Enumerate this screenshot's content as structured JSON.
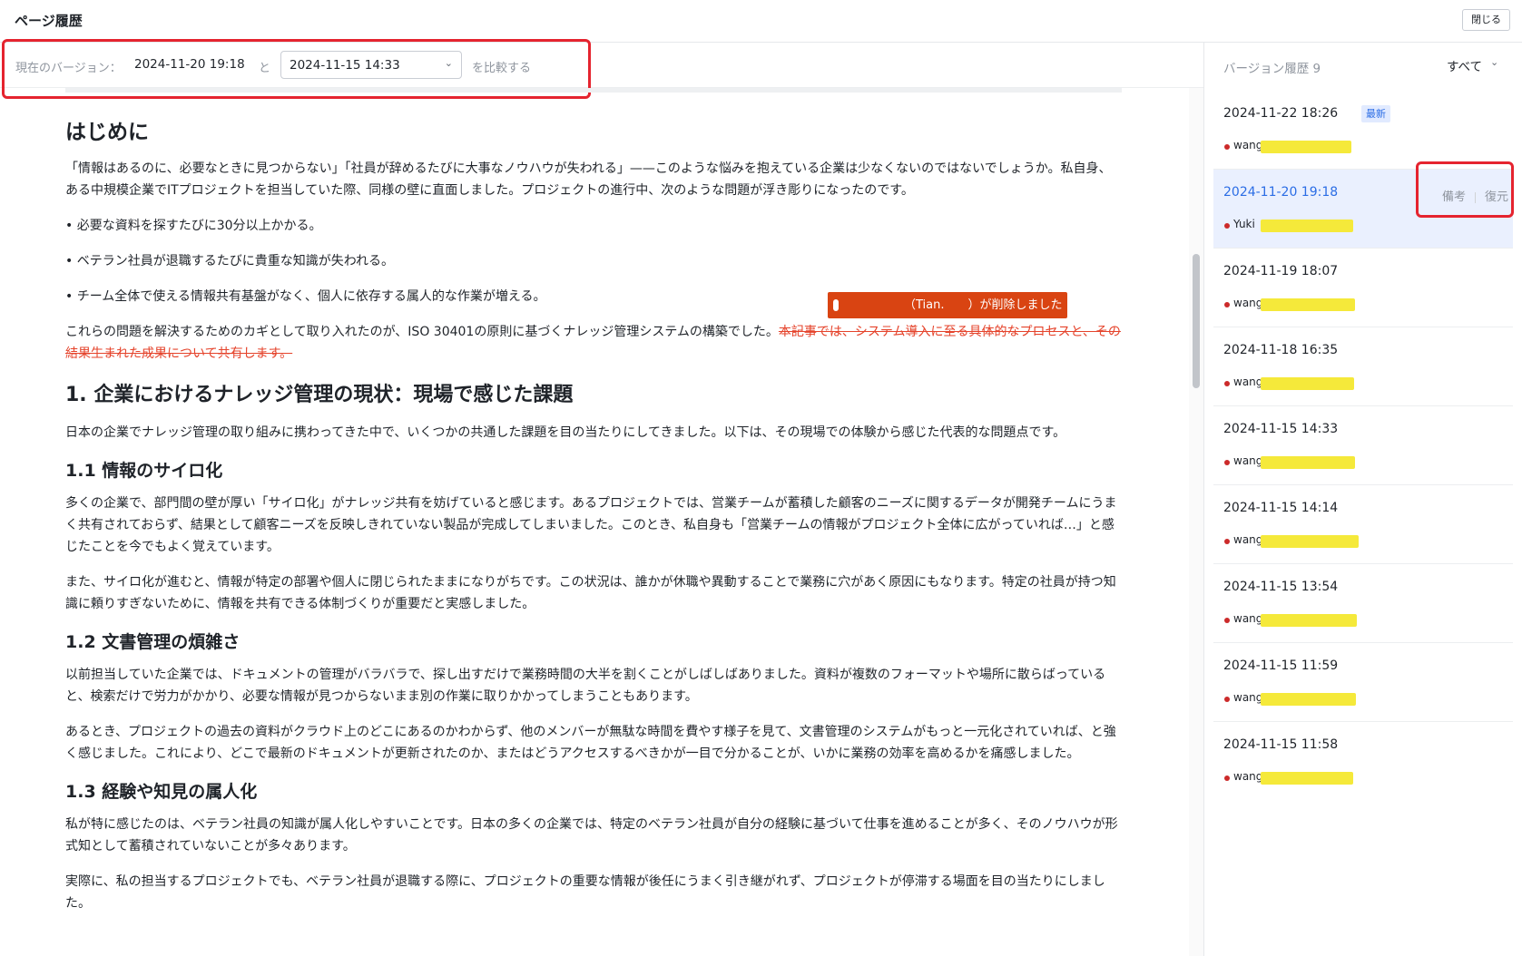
{
  "header": {
    "title": "ページ履歴",
    "close_label": "閉じる"
  },
  "compare": {
    "label": "現在のバージョン：",
    "current_version": "2024-11-20 19:18",
    "and": "と",
    "selected_version": "2024-11-15 14:33",
    "suffix": "を比較する"
  },
  "document": {
    "h_intro": "はじめに",
    "p_intro": "「情報はあるのに、必要なときに見つからない」「社員が辞めるたびに大事なノウハウが失われる」——このような悩みを抱えている企業は少なくないのではないでしょうか。私自身、ある中規模企業でITプロジェクトを担当していた際、同様の壁に直面しました。プロジェクトの進行中、次のような問題が浮き彫りになったのです。",
    "bullets": [
      "• 必要な資料を探すたびに30分以上かかる。",
      "• ベテラン社員が退職するたびに貴重な知識が失われる。",
      "• チーム全体で使える情報共有基盤がなく、個人に依存する属人的な作業が増える。"
    ],
    "p_solution": "これらの問題を解決するためのカギとして取り入れたのが、ISO 30401の原則に基づくナレッジ管理システムの構築でした。",
    "p_deleted": "本記事では、システム導入に至る具体的なプロセスと、その結果生まれた成果について共有します。",
    "h_1": "1. 企業におけるナレッジ管理の現状：現場で感じた課題",
    "p_1": "日本の企業でナレッジ管理の取り組みに携わってきた中で、いくつかの共通した課題を目の当たりにしてきました。以下は、その現場での体験から感じた代表的な問題点です。",
    "h_1_1": "1.1 情報のサイロ化",
    "p_1_1a": "多くの企業で、部門間の壁が厚い「サイロ化」がナレッジ共有を妨げていると感じます。あるプロジェクトでは、営業チームが蓄積した顧客のニーズに関するデータが開発チームにうまく共有されておらず、結果として顧客ニーズを反映しきれていない製品が完成してしまいました。このとき、私自身も「営業チームの情報がプロジェクト全体に広がっていれば…」と感じたことを今でもよく覚えています。",
    "p_1_1b": "また、サイロ化が進むと、情報が特定の部署や個人に閉じられたままになりがちです。この状況は、誰かが休職や異動することで業務に穴があく原因にもなります。特定の社員が持つ知識に頼りすぎないために、情報を共有できる体制づくりが重要だと実感しました。",
    "h_1_2": "1.2 文書管理の煩雑さ",
    "p_1_2a": "以前担当していた企業では、ドキュメントの管理がバラバラで、探し出すだけで業務時間の大半を割くことがしばしばありました。資料が複数のフォーマットや場所に散らばっていると、検索だけで労力がかかり、必要な情報が見つからないまま別の作業に取りかかってしまうこともあります。",
    "p_1_2b": "あるとき、プロジェクトの過去の資料がクラウド上のどこにあるのかわからず、他のメンバーが無駄な時間を費やす様子を見て、文書管理のシステムがもっと一元化されていれば、と強く感じました。これにより、どこで最新のドキュメントが更新されたのか、またはどうアクセスするべきかが一目で分かることが、いかに業務の効率を高めるかを痛感しました。",
    "h_1_3": "1.3 経験や知見の属人化",
    "p_1_3a": "私が特に感じたのは、ベテラン社員の知識が属人化しやすいことです。日本の多くの企業では、特定のベテラン社員が自分の経験に基づいて仕事を進めることが多く、そのノウハウが形式知として蓄積されていないことが多々あります。",
    "p_1_3b": "実際に、私の担当するプロジェクトでも、ベテラン社員が退職する際に、プロジェクトの重要な情報が後任にうまく引き継がれず、プロジェクトが停滞する場面を目の当たりにしました。"
  },
  "tooltip": {
    "text": "（Tian.　　）が削除しました"
  },
  "sidebar": {
    "title": "バージョン履歴 9",
    "filter": "すべて",
    "latest_badge": "最新",
    "actions": {
      "note": "備考",
      "restore": "復元"
    },
    "versions": [
      {
        "time": "2024-11-22 18:26",
        "author": "wang"
      },
      {
        "time": "2024-11-20 19:18",
        "author": "Yuki"
      },
      {
        "time": "2024-11-19 18:07",
        "author": "wang"
      },
      {
        "time": "2024-11-18 16:35",
        "author": "wang"
      },
      {
        "time": "2024-11-15 14:33",
        "author": "wang"
      },
      {
        "time": "2024-11-15 14:14",
        "author": "wang"
      },
      {
        "time": "2024-11-15 13:54",
        "author": "wang"
      },
      {
        "time": "2024-11-15 11:59",
        "author": "wang"
      },
      {
        "time": "2024-11-15 11:58",
        "author": "wang"
      }
    ]
  },
  "colors": {
    "accent": "#2b6de5",
    "annotation_red": "#e5242f",
    "deleted_text": "#e5432b",
    "tooltip_bg": "#d94412",
    "redaction_yellow": "#f5e93a"
  }
}
